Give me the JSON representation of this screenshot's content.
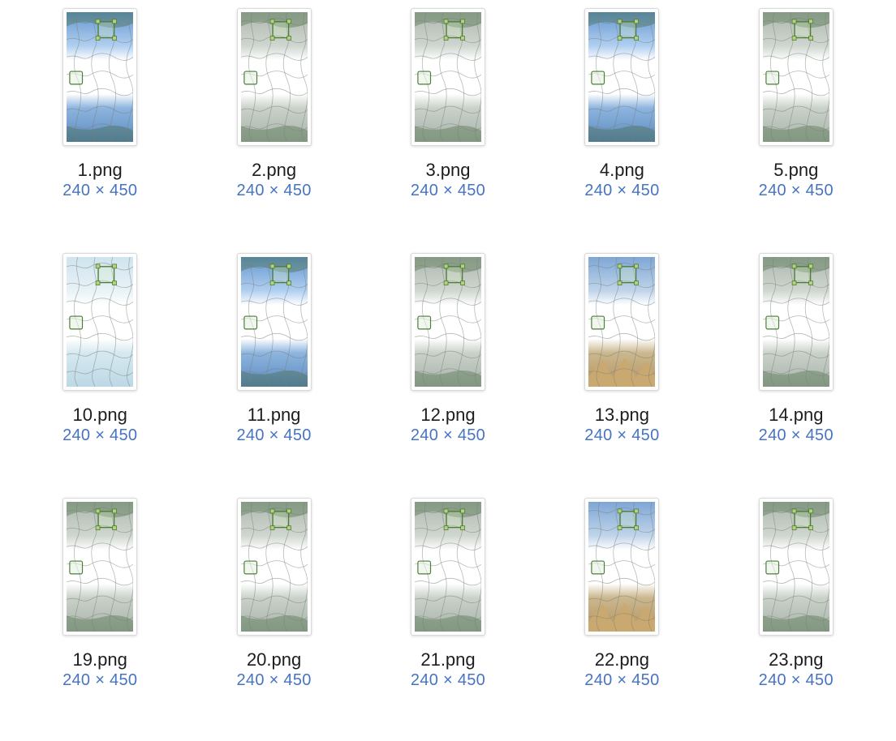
{
  "items": [
    {
      "filename": "1.png",
      "dimensions": "240 × 450",
      "variant": "sky"
    },
    {
      "filename": "2.png",
      "dimensions": "240 × 450",
      "variant": "grey"
    },
    {
      "filename": "3.png",
      "dimensions": "240 × 450",
      "variant": "grey"
    },
    {
      "filename": "4.png",
      "dimensions": "240 × 450",
      "variant": "sky"
    },
    {
      "filename": "5.png",
      "dimensions": "240 × 450",
      "variant": "grey"
    },
    {
      "filename": "10.png",
      "dimensions": "240 × 450",
      "variant": "pale"
    },
    {
      "filename": "11.png",
      "dimensions": "240 × 450",
      "variant": "sky"
    },
    {
      "filename": "12.png",
      "dimensions": "240 × 450",
      "variant": "grey"
    },
    {
      "filename": "13.png",
      "dimensions": "240 × 450",
      "variant": "sand"
    },
    {
      "filename": "14.png",
      "dimensions": "240 × 450",
      "variant": "grey"
    },
    {
      "filename": "19.png",
      "dimensions": "240 × 450",
      "variant": "grey"
    },
    {
      "filename": "20.png",
      "dimensions": "240 × 450",
      "variant": "grey"
    },
    {
      "filename": "21.png",
      "dimensions": "240 × 450",
      "variant": "grey"
    },
    {
      "filename": "22.png",
      "dimensions": "240 × 450",
      "variant": "sand"
    },
    {
      "filename": "23.png",
      "dimensions": "240 × 450",
      "variant": "grey"
    }
  ]
}
